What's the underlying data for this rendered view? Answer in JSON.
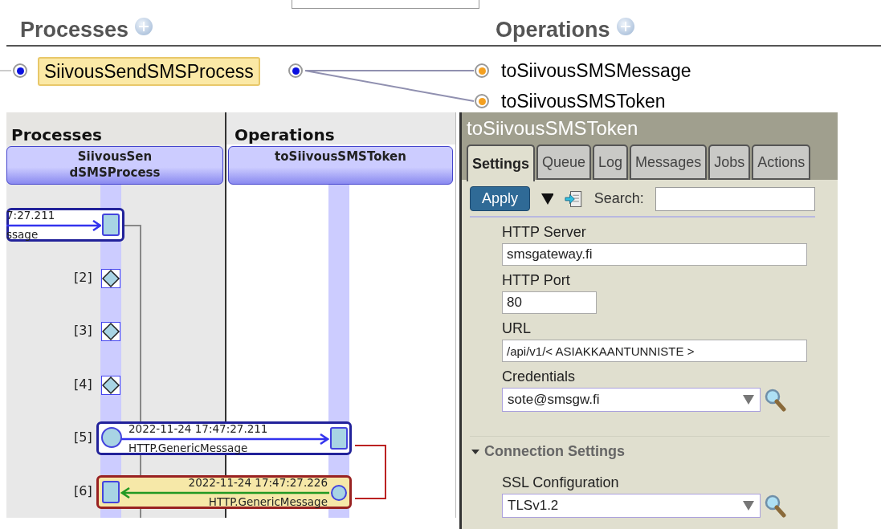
{
  "production": {
    "processes_heading": "Processes",
    "operations_heading": "Operations",
    "processes": [
      {
        "name": "SiivousSendSMSProcess",
        "selected": true
      }
    ],
    "operations": [
      {
        "name": "toSiivousSMSMessage"
      },
      {
        "name": "toSiivousSMSToken"
      }
    ]
  },
  "trace": {
    "columns": [
      "Processes",
      "Operations"
    ],
    "lanes": [
      {
        "lines": [
          "SiivousSen",
          "dSMSProcess"
        ]
      },
      {
        "lines": [
          "toSiivousSMSToken"
        ]
      }
    ],
    "events": [
      {
        "kind": "message",
        "time": "7:27.211",
        "type": "ssage"
      },
      {
        "kind": "step",
        "index": "[2]"
      },
      {
        "kind": "step",
        "index": "[3]"
      },
      {
        "kind": "step",
        "index": "[4]"
      },
      {
        "kind": "request",
        "index": "[5]",
        "time": "2022-11-24 17:47:27.211",
        "type": "HTTP.GenericMessage"
      },
      {
        "kind": "response",
        "index": "[6]",
        "time": "2022-11-24 17:47:27.226",
        "type": "HTTP.GenericMessage"
      }
    ]
  },
  "settings": {
    "title": "toSiivousSMSToken",
    "tabs": [
      {
        "label": "Settings",
        "selected": true
      },
      {
        "label": "Queue",
        "selected": false
      },
      {
        "label": "Log",
        "selected": false
      },
      {
        "label": "Messages",
        "selected": false
      },
      {
        "label": "Jobs",
        "selected": false
      },
      {
        "label": "Actions",
        "selected": false
      }
    ],
    "apply": "Apply",
    "search_label": "Search:",
    "fields": [
      {
        "kind": "text",
        "label": "HTTP Server",
        "value": "smsgateway.fi"
      },
      {
        "kind": "number",
        "label": "HTTP Port",
        "value": "80"
      },
      {
        "kind": "text",
        "label": "URL",
        "value": "/api/v1/< ASIAKKAANTUNNISTE >"
      },
      {
        "kind": "select",
        "label": "Credentials",
        "value": "sote@smsgw.fi"
      }
    ],
    "section": {
      "title": "Connection Settings",
      "expanded": true,
      "fields": [
        {
          "kind": "select",
          "label": "SSL Configuration",
          "value": "TLSv1.2"
        }
      ]
    }
  }
}
